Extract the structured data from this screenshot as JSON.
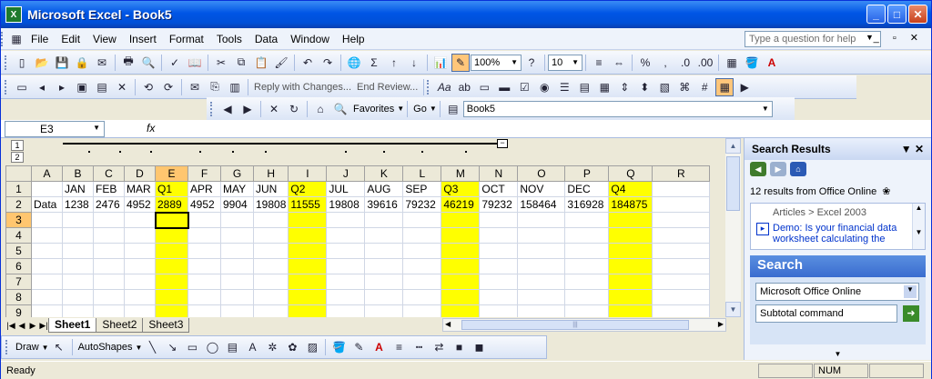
{
  "window": {
    "title": "Microsoft Excel - Book5",
    "icon": "excel-icon",
    "minimize": "_",
    "maximize": "□",
    "close": "✕"
  },
  "menu": {
    "items": [
      "File",
      "Edit",
      "View",
      "Insert",
      "Format",
      "Tools",
      "Data",
      "Window",
      "Help"
    ],
    "help_placeholder": "Type a question for help"
  },
  "toolbar": {
    "zoom": "100%",
    "font_size": "10",
    "reviewing_reply": "Reply with Changes...",
    "reviewing_end": "End Review...",
    "favorites": "Favorites",
    "go": "Go",
    "address": "Book5",
    "comma": ",",
    "percent": "%"
  },
  "formula_bar": {
    "name_box": "E3",
    "fx": "fx",
    "content": ""
  },
  "outline": {
    "level1": "1",
    "level2": "2",
    "collapse": "−"
  },
  "sheet": {
    "columns": [
      "A",
      "B",
      "C",
      "D",
      "E",
      "F",
      "G",
      "H",
      "I",
      "J",
      "K",
      "L",
      "M",
      "N",
      "O",
      "P",
      "Q",
      "R"
    ],
    "highlight_columns": [
      "E",
      "I",
      "M",
      "Q"
    ],
    "rows": [
      {
        "num": "1",
        "cells": [
          "",
          "JAN",
          "FEB",
          "MAR",
          "Q1",
          "APR",
          "MAY",
          "JUN",
          "Q2",
          "JUL",
          "AUG",
          "SEP",
          "Q3",
          "OCT",
          "NOV",
          "DEC",
          "Q4",
          ""
        ]
      },
      {
        "num": "2",
        "cells": [
          "Data",
          "1238",
          "2476",
          "4952",
          "2889",
          "4952",
          "9904",
          "19808",
          "11555",
          "19808",
          "39616",
          "79232",
          "46219",
          "79232",
          "158464",
          "316928",
          "184875",
          ""
        ]
      },
      {
        "num": "3",
        "cells": [
          "",
          "",
          "",
          "",
          "",
          "",
          "",
          "",
          "",
          "",
          "",
          "",
          "",
          "",
          "",
          "",
          "",
          ""
        ]
      },
      {
        "num": "4",
        "cells": [
          "",
          "",
          "",
          "",
          "",
          "",
          "",
          "",
          "",
          "",
          "",
          "",
          "",
          "",
          "",
          "",
          "",
          ""
        ]
      },
      {
        "num": "5",
        "cells": [
          "",
          "",
          "",
          "",
          "",
          "",
          "",
          "",
          "",
          "",
          "",
          "",
          "",
          "",
          "",
          "",
          "",
          ""
        ]
      },
      {
        "num": "6",
        "cells": [
          "",
          "",
          "",
          "",
          "",
          "",
          "",
          "",
          "",
          "",
          "",
          "",
          "",
          "",
          "",
          "",
          "",
          ""
        ]
      },
      {
        "num": "7",
        "cells": [
          "",
          "",
          "",
          "",
          "",
          "",
          "",
          "",
          "",
          "",
          "",
          "",
          "",
          "",
          "",
          "",
          "",
          ""
        ]
      },
      {
        "num": "8",
        "cells": [
          "",
          "",
          "",
          "",
          "",
          "",
          "",
          "",
          "",
          "",
          "",
          "",
          "",
          "",
          "",
          "",
          "",
          ""
        ]
      },
      {
        "num": "9",
        "cells": [
          "",
          "",
          "",
          "",
          "",
          "",
          "",
          "",
          "",
          "",
          "",
          "",
          "",
          "",
          "",
          "",
          "",
          ""
        ]
      }
    ],
    "active_cell": "E3",
    "highlight_color": "#ffff00",
    "tabs": [
      "Sheet1",
      "Sheet2",
      "Sheet3"
    ],
    "active_tab": "Sheet1"
  },
  "drawing_toolbar": {
    "draw": "Draw",
    "autoshapes": "AutoShapes"
  },
  "status": {
    "text": "Ready",
    "num": "NUM"
  },
  "task_pane": {
    "title": "Search Results",
    "results_count": "12 results from Office Online",
    "result_breadcrumb": "Articles > Excel 2003",
    "result_title": "Demo: Is your financial data worksheet calculating the",
    "search_heading": "Search",
    "search_scope": "Microsoft Office Online",
    "search_query": "Subtotal command"
  },
  "colors": {
    "title_bar": "#0055e5",
    "cell_highlight": "#ffff00",
    "selected_header": "#ffc66f"
  }
}
